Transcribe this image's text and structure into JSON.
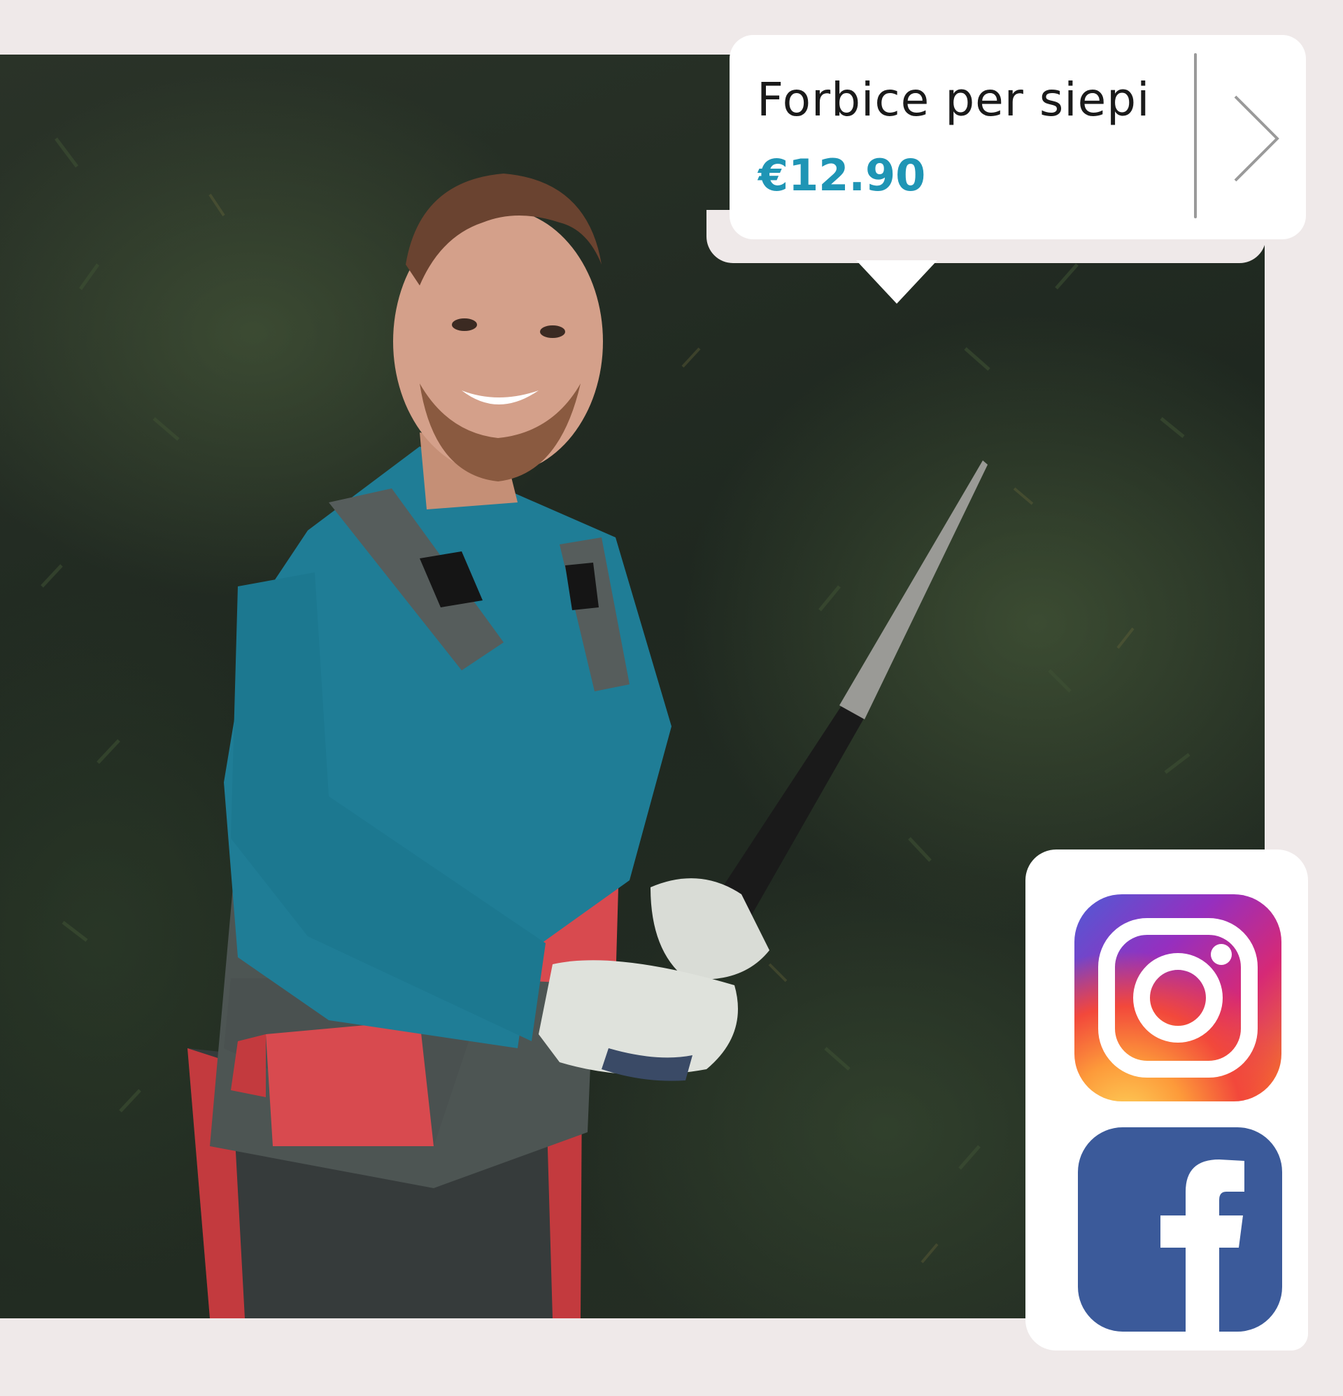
{
  "product": {
    "title": "Forbice per siepi",
    "price": "€12.90"
  },
  "icons": {
    "next": "chevron-right-icon",
    "instagram": "instagram-icon",
    "facebook": "facebook-icon"
  },
  "colors": {
    "price": "#1f95b5",
    "background": "#efe9e9",
    "facebook": "#3b5a9a"
  }
}
